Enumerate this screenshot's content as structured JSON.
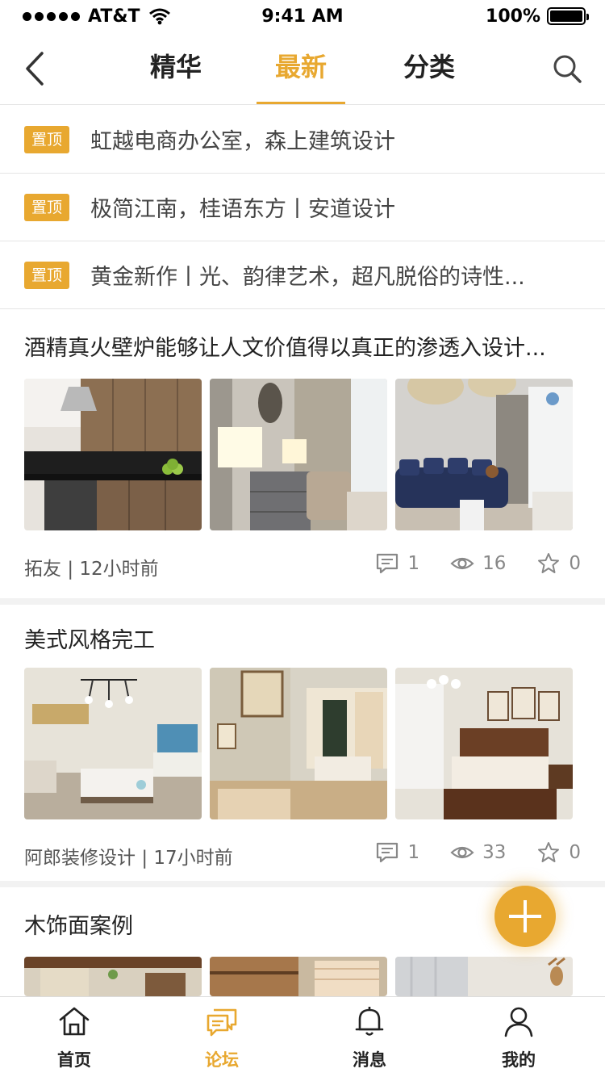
{
  "status_bar": {
    "carrier": "AT&T",
    "time": "9:41 AM",
    "battery": "100%"
  },
  "nav": {
    "tabs": [
      "精华",
      "最新",
      "分类"
    ],
    "active_tab": "最新"
  },
  "pinned": [
    {
      "badge": "置顶",
      "title": "虹越电商办公室，森上建筑设计"
    },
    {
      "badge": "置顶",
      "title": "极简江南，桂语东方丨安道设计"
    },
    {
      "badge": "置顶",
      "title": "黄金新作丨光、韵律艺术，超凡脱俗的诗性..."
    }
  ],
  "posts": [
    {
      "title": "酒精真火壁炉能够让人文价值得以真正的渗透入设计...",
      "author": "拓友",
      "time": "12小时前",
      "comments": "1",
      "views": "16",
      "favorites": "0"
    },
    {
      "title": "美式风格完工",
      "author": "阿郎装修设计",
      "time": "17小时前",
      "comments": "1",
      "views": "33",
      "favorites": "0"
    },
    {
      "title": "木饰面案例"
    }
  ],
  "tab_bar": {
    "items": [
      "首页",
      "论坛",
      "消息",
      "我的"
    ],
    "active": "论坛"
  },
  "colors": {
    "accent": "#e8a830",
    "divider": "#e5e5e5",
    "text": "#222222",
    "meta": "#888888"
  }
}
